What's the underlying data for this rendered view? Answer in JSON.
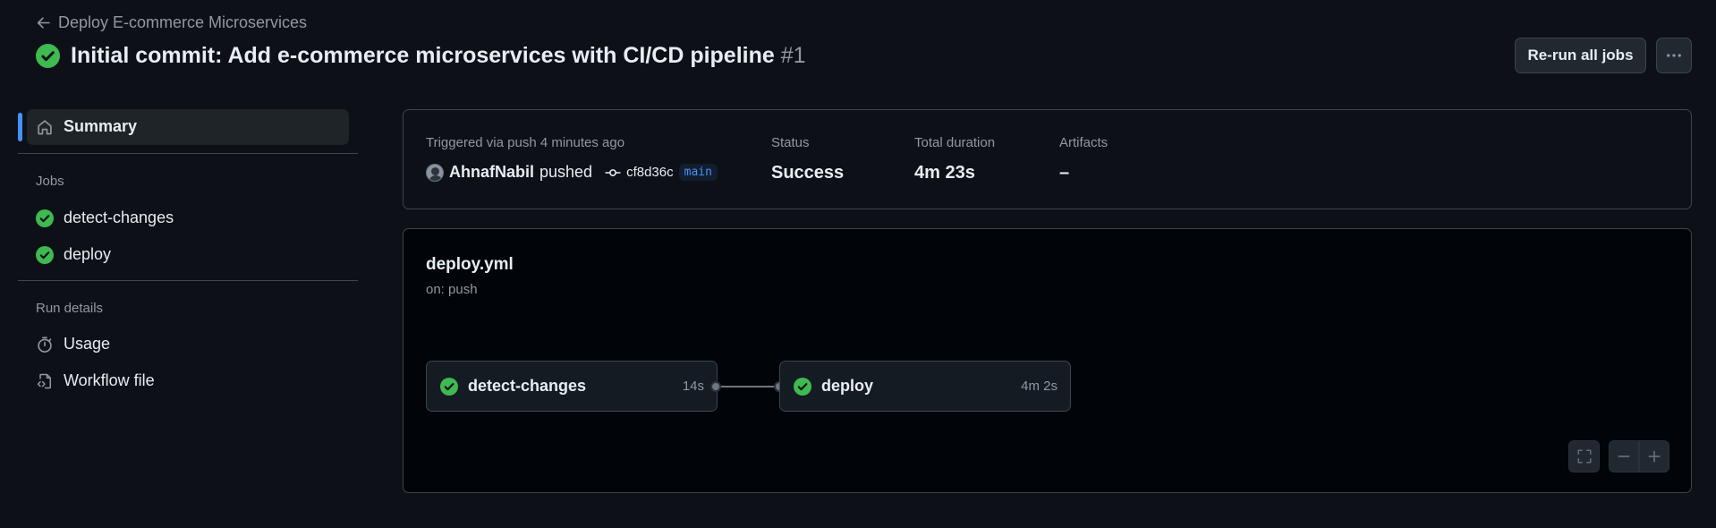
{
  "header": {
    "back_label": "Deploy E-commerce Microservices",
    "title": "Initial commit: Add e-commerce microservices with CI/CD pipeline",
    "run_number": "#1",
    "rerun_label": "Re-run all jobs"
  },
  "sidebar": {
    "summary_label": "Summary",
    "jobs_heading": "Jobs",
    "jobs": [
      {
        "label": "detect-changes",
        "status": "success"
      },
      {
        "label": "deploy",
        "status": "success"
      }
    ],
    "run_details_heading": "Run details",
    "usage_label": "Usage",
    "workflow_file_label": "Workflow file"
  },
  "summary": {
    "trigger_label": "Triggered via push 4 minutes ago",
    "actor": "AhnafNabil",
    "action": "pushed",
    "commit_sha": "cf8d36c",
    "branch": "main",
    "status_label": "Status",
    "status_value": "Success",
    "duration_label": "Total duration",
    "duration_value": "4m 23s",
    "artifacts_label": "Artifacts",
    "artifacts_value": "–"
  },
  "workflow": {
    "file_name": "deploy.yml",
    "trigger": "on: push",
    "jobs": [
      {
        "name": "detect-changes",
        "duration": "14s"
      },
      {
        "name": "deploy",
        "duration": "4m 2s"
      }
    ]
  },
  "icons": {
    "success": "check-circle-fill-icon",
    "back": "arrow-left-icon",
    "more": "kebab-horizontal-icon",
    "summary": "home-icon",
    "usage": "stopwatch-icon",
    "workflow_file": "file-code-icon",
    "commit": "git-commit-icon",
    "fullscreen": "screen-full-icon",
    "zoom_out": "dash-icon",
    "zoom_in": "plus-icon"
  },
  "colors": {
    "success": "#3fb950",
    "accent": "#4493f8",
    "background": "#0d1117"
  }
}
